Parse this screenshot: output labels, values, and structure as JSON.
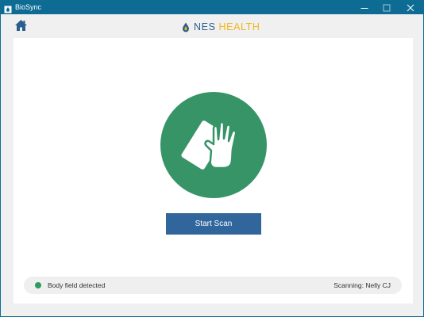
{
  "window": {
    "title": "BioSync",
    "controls": {
      "minimize_icon": "minimize-icon",
      "maximize_icon": "maximize-icon",
      "close_icon": "close-icon"
    }
  },
  "header": {
    "home_icon": "home-icon",
    "logo": {
      "brand": "NES",
      "brand_accent": "HEALTH",
      "colors": {
        "brand": "#2b5f8f",
        "accent": "#f2b51b"
      }
    }
  },
  "main": {
    "scan_icon": "hand-on-card-icon",
    "start_button_label": "Start Scan"
  },
  "status": {
    "detected_text": "Body field detected",
    "scanning_text": "Scanning: Nelly CJ",
    "indicator_color": "#2f9b62"
  },
  "colors": {
    "titlebar": "#0e6c94",
    "circle": "#379467",
    "button": "#30669c"
  }
}
